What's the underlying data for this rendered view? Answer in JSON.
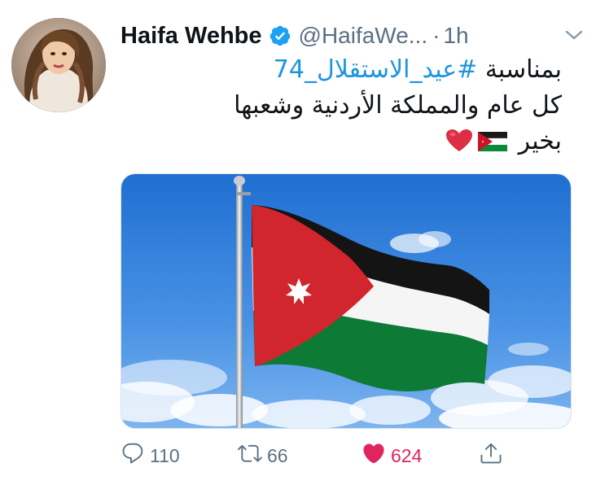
{
  "tweet": {
    "author_name": "Haifa Wehbe",
    "handle": "@HaifaWe...",
    "separator": "·",
    "time": "1h",
    "text_line1_prefix": "بمناسبة ",
    "hashtag": "#عيد_الاستقلال_74",
    "text_line2": "كل عام والمملكة الأردنية وشعبها",
    "text_line3": "بخير"
  },
  "actions": {
    "replies": "110",
    "retweets": "66",
    "likes": "624"
  },
  "colors": {
    "verified": "#1da1f2",
    "hashtag": "#1b95e0",
    "liked": "#e0245e",
    "muted": "#5b7083"
  },
  "icons": {
    "verified": "verified-badge-icon",
    "more": "chevron-down-icon",
    "reply": "reply-bubble-icon",
    "retweet": "retweet-icon",
    "like": "heart-icon",
    "share": "share-icon"
  }
}
